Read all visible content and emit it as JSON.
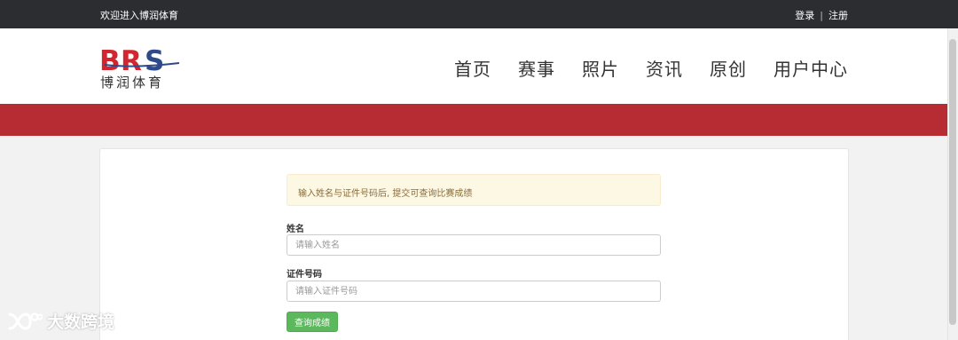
{
  "topbar": {
    "welcome": "欢迎进入博润体育",
    "login": "登录",
    "separator": "|",
    "register": "注册"
  },
  "header": {
    "logo_text": "BRS",
    "logo_subtitle": "博润体育",
    "nav": [
      {
        "label": "首页"
      },
      {
        "label": "赛事"
      },
      {
        "label": "照片"
      },
      {
        "label": "资讯"
      },
      {
        "label": "原创"
      },
      {
        "label": "用户中心"
      }
    ]
  },
  "colors": {
    "topbar_bg": "#2b2d31",
    "accent_red": "#b72b33",
    "logo_blue": "#2e4a8a",
    "button_green": "#5cb85c",
    "alert_bg": "#fcf8e3"
  },
  "form": {
    "notice": "输入姓名与证件号码后, 提交可查询比赛成绩",
    "name_label": "姓名",
    "name_placeholder": "请输入姓名",
    "name_value": "",
    "id_label": "证件号码",
    "id_placeholder": "请输入证件号码",
    "id_value": "",
    "submit_label": "查询成绩"
  },
  "watermark": {
    "icon": "wechat-channel-icon",
    "text": "大数跨境"
  }
}
